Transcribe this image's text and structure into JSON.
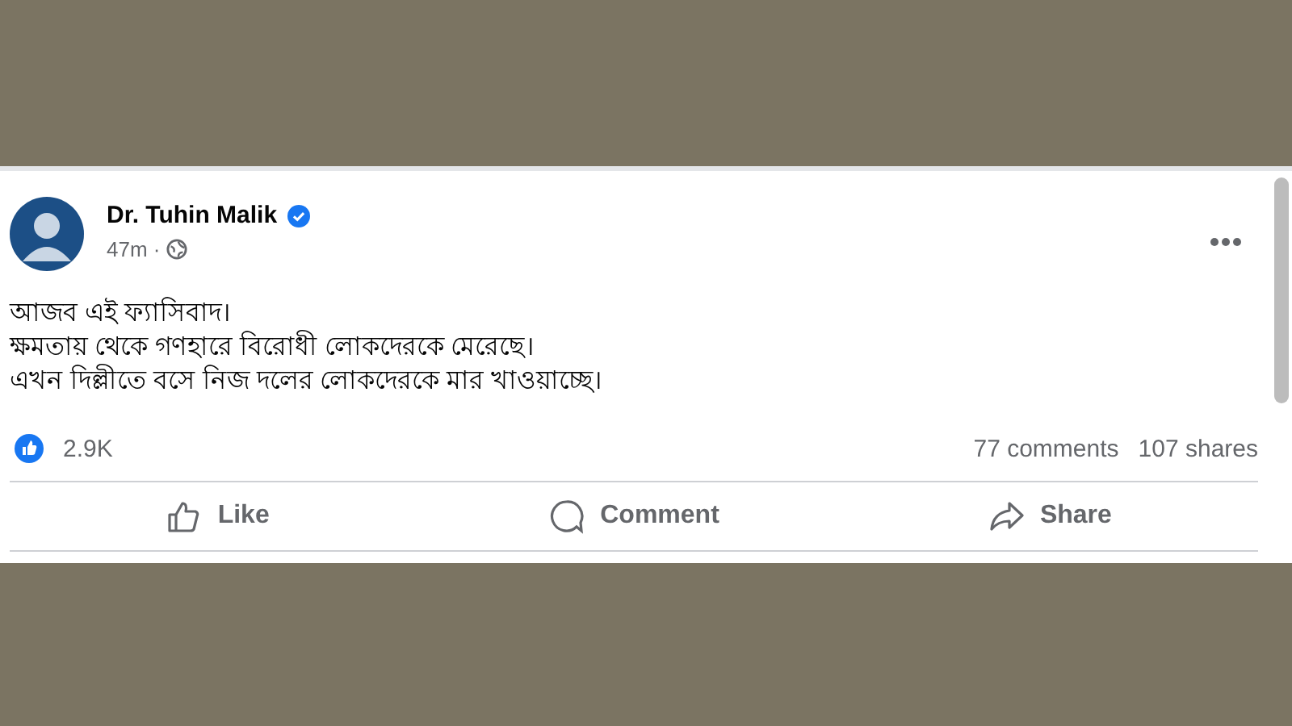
{
  "post": {
    "author": "Dr. Tuhin Malik",
    "verified": true,
    "time": "47m ·",
    "text": "আজব এই ফ্যাসিবাদ।\nক্ষমতায় থেকে গণহারে বিরোধী লোকদেরকে মেরেছে।\nএখন দিল্লীতে বসে নিজ দলের লোকদেরকে মার খাওয়াচ্ছে।",
    "reactions": "2.9K",
    "comments": "77 comments",
    "shares": "107 shares",
    "actions": [
      {
        "kind": "like",
        "label": "Like"
      },
      {
        "kind": "comment",
        "label": "Comment"
      },
      {
        "kind": "share",
        "label": "Share"
      }
    ]
  }
}
